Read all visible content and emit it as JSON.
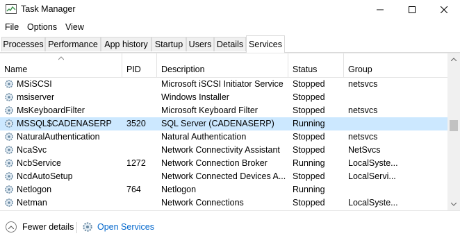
{
  "window": {
    "title": "Task Manager"
  },
  "menu": [
    "File",
    "Options",
    "View"
  ],
  "tabs": [
    "Processes",
    "Performance",
    "App history",
    "Startup",
    "Users",
    "Details",
    "Services"
  ],
  "active_tab": "Services",
  "columns": {
    "name": "Name",
    "pid": "PID",
    "description": "Description",
    "status": "Status",
    "group": "Group"
  },
  "rows": [
    {
      "name": "MSiSCSI",
      "pid": "",
      "description": "Microsoft iSCSI Initiator Service",
      "status": "Stopped",
      "group": "netsvcs"
    },
    {
      "name": "msiserver",
      "pid": "",
      "description": "Windows Installer",
      "status": "Stopped",
      "group": ""
    },
    {
      "name": "MsKeyboardFilter",
      "pid": "",
      "description": "Microsoft Keyboard Filter",
      "status": "Stopped",
      "group": "netsvcs"
    },
    {
      "name": "MSSQL$CADENASERP",
      "pid": "3520",
      "description": "SQL Server (CADENASERP)",
      "status": "Running",
      "group": ""
    },
    {
      "name": "NaturalAuthentication",
      "pid": "",
      "description": "Natural Authentication",
      "status": "Stopped",
      "group": "netsvcs"
    },
    {
      "name": "NcaSvc",
      "pid": "",
      "description": "Network Connectivity Assistant",
      "status": "Stopped",
      "group": "NetSvcs"
    },
    {
      "name": "NcbService",
      "pid": "1272",
      "description": "Network Connection Broker",
      "status": "Running",
      "group": "LocalSyste..."
    },
    {
      "name": "NcdAutoSetup",
      "pid": "",
      "description": "Network Connected Devices A...",
      "status": "Stopped",
      "group": "LocalServi..."
    },
    {
      "name": "Netlogon",
      "pid": "764",
      "description": "Netlogon",
      "status": "Running",
      "group": ""
    },
    {
      "name": "Netman",
      "pid": "",
      "description": "Network Connections",
      "status": "Stopped",
      "group": "LocalSyste..."
    }
  ],
  "selected_row": "MSSQL$CADENASERP",
  "footer": {
    "fewer_details": "Fewer details",
    "open_services": "Open Services"
  }
}
